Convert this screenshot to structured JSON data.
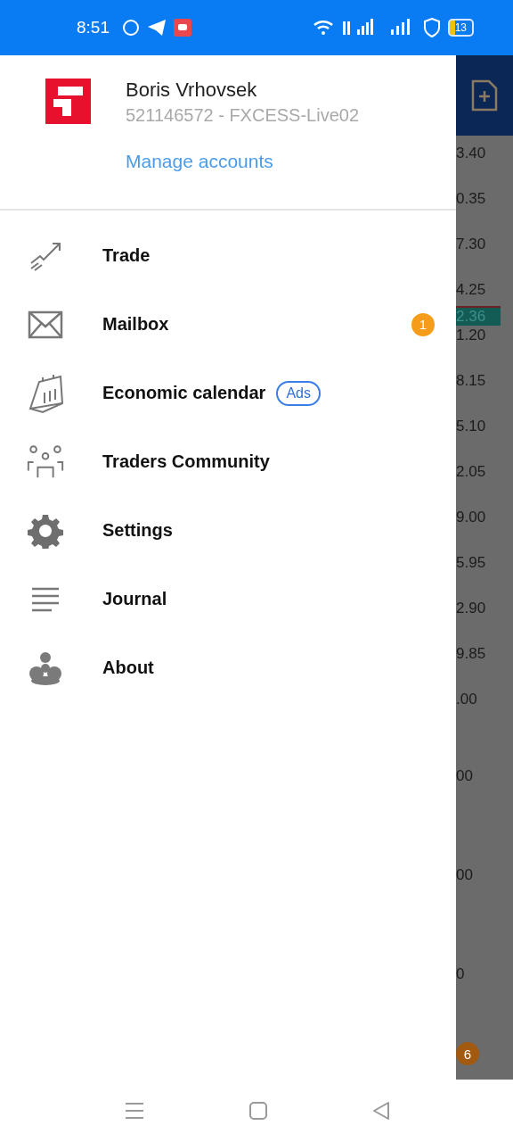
{
  "status_bar": {
    "time": "8:51",
    "battery": "13"
  },
  "drawer": {
    "account": {
      "name": "Boris  Vrhovsek",
      "server": "521146572 - FXCESS-Live02",
      "manage_link": "Manage accounts"
    },
    "items": [
      {
        "kind": "trade",
        "label": "Trade"
      },
      {
        "kind": "mail",
        "label": "Mailbox",
        "badge": "1"
      },
      {
        "kind": "calendar",
        "label": "Economic calendar",
        "tag": "Ads"
      },
      {
        "kind": "community",
        "label": "Traders Community"
      },
      {
        "kind": "settings",
        "label": "Settings"
      },
      {
        "kind": "journal",
        "label": "Journal"
      },
      {
        "kind": "about",
        "label": "About"
      }
    ]
  },
  "background": {
    "prices": [
      "3.40",
      "0.35",
      "7.30",
      "4.25",
      "1.20",
      "8.15",
      "5.10",
      "2.05",
      "9.00",
      "5.95",
      "2.90",
      "9.85",
      ".00"
    ],
    "lower_prices": [
      "00",
      "00",
      "0"
    ],
    "price_tag": "2.36",
    "badge": "6"
  }
}
